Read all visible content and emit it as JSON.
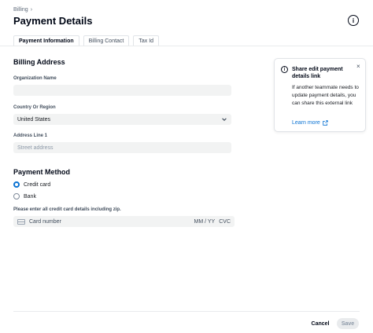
{
  "breadcrumb": {
    "item": "Billing",
    "separator": "›"
  },
  "page": {
    "title": "Payment Details",
    "info_icon": "info-icon"
  },
  "tabs": [
    {
      "label": "Payment Information",
      "active": true
    },
    {
      "label": "Billing Contact",
      "active": false
    },
    {
      "label": "Tax Id",
      "active": false
    }
  ],
  "billing_address": {
    "heading": "Billing Address",
    "organization": {
      "label": "Organization Name",
      "value": "",
      "placeholder": ""
    },
    "country": {
      "label": "Country Or Region",
      "value": "United States"
    },
    "address1": {
      "label": "Address Line 1",
      "value": "",
      "placeholder": "Street address"
    }
  },
  "payment_method": {
    "heading": "Payment Method",
    "options": [
      {
        "label": "Credit card",
        "checked": true
      },
      {
        "label": "Bank",
        "checked": false
      }
    ],
    "helper": "Please enter all credit card details including zip.",
    "card": {
      "number_placeholder": "Card number",
      "expiry_placeholder": "MM / YY",
      "cvc_placeholder": "CVC"
    }
  },
  "info_panel": {
    "title": "Share edit payment details link",
    "body": "If another teammate needs to update payment details, you can share this external link",
    "link": "Learn more",
    "close": "×"
  },
  "footer": {
    "cancel": "Cancel",
    "save": "Save"
  },
  "colors": {
    "accent": "#0972d3",
    "text": "#000716",
    "input_bg": "#f2f3f3"
  }
}
